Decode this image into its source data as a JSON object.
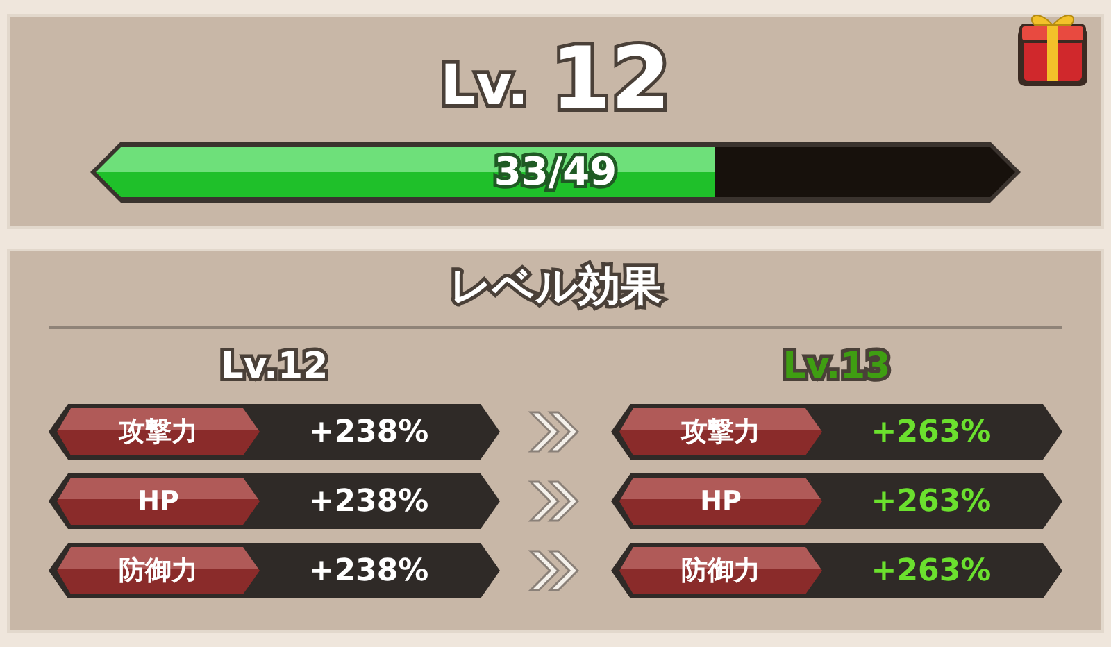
{
  "header": {
    "level_label": "Lv.",
    "level": "12",
    "progress": {
      "text": "33/49",
      "level": 0.673
    }
  },
  "effects": {
    "title": "レベル効果",
    "current": {
      "label": "Lv.12",
      "stats": [
        {
          "name": "攻撃力",
          "value": "+238%"
        },
        {
          "name": "HP",
          "value": "+238%"
        },
        {
          "name": "防御力",
          "value": "+238%"
        }
      ]
    },
    "next": {
      "label": "Lv.13",
      "stats": [
        {
          "name": "攻撃力",
          "value": "+263%"
        },
        {
          "name": "HP",
          "value": "+263%"
        },
        {
          "name": "防御力",
          "value": "+263%"
        }
      ]
    }
  }
}
